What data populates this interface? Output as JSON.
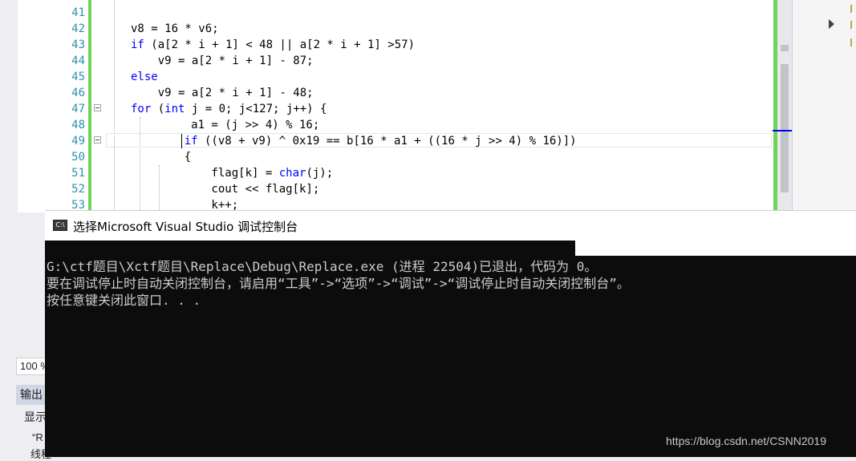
{
  "editor": {
    "line_numbers": [
      "41",
      "42",
      "43",
      "44",
      "45",
      "46",
      "47",
      "48",
      "49",
      "50",
      "51",
      "52",
      "53"
    ],
    "lines": [
      {
        "num": "42",
        "tokens": [
          {
            "t": "v8 = 16 * v6;",
            "k": 0
          }
        ]
      },
      {
        "num": "43",
        "tokens": [
          {
            "t": "if",
            "k": 1
          },
          {
            "t": " (a[2 * i + 1] < 48 || a[2 * i + 1] >57)",
            "k": 0
          }
        ]
      },
      {
        "num": "44",
        "tokens": [
          {
            "t": "    v9 = a[2 * i + 1] - 87;",
            "k": 0
          }
        ]
      },
      {
        "num": "45",
        "tokens": [
          {
            "t": "else",
            "k": 1
          }
        ]
      },
      {
        "num": "46",
        "tokens": [
          {
            "t": "    v9 = a[2 * i + 1] - 48;",
            "k": 0
          }
        ]
      },
      {
        "num": "47",
        "tokens": [
          {
            "t": "for",
            "k": 1
          },
          {
            "t": " (",
            "k": 0
          },
          {
            "t": "int",
            "k": 1
          },
          {
            "t": " j = 0; j<127; j++) {",
            "k": 0
          }
        ]
      },
      {
        "num": "48",
        "tokens": [
          {
            "t": "     a1 = (j >> 4) % 16;",
            "k": 0
          }
        ]
      },
      {
        "num": "49",
        "tokens": [
          {
            "t": "    ",
            "k": 0
          },
          {
            "t": "if",
            "k": 1
          },
          {
            "t": " ((v8 + v9) ^ 0x19 == b[16 * a1 + ((16 * j >> 4) % 16)])",
            "k": 0
          }
        ]
      },
      {
        "num": "50",
        "tokens": [
          {
            "t": "    {",
            "k": 0
          }
        ]
      },
      {
        "num": "51",
        "tokens": [
          {
            "t": "        flag[k] = ",
            "k": 0
          },
          {
            "t": "char",
            "k": 1
          },
          {
            "t": "(j);",
            "k": 0
          }
        ]
      },
      {
        "num": "52",
        "tokens": [
          {
            "t": "        cout << flag[k];",
            "k": 0
          }
        ]
      },
      {
        "num": "53",
        "tokens": [
          {
            "t": "        k++;",
            "k": 0
          }
        ]
      }
    ]
  },
  "zoom": {
    "label": "100 %"
  },
  "output": {
    "tab_label": "输出",
    "show_label": "显示",
    "fragment1": "“R",
    "fragment2": "线程"
  },
  "console": {
    "title": "选择Microsoft Visual Studio 调试控制台",
    "icon_text": "C:\\",
    "lines": [
      "G:\\ctf题目\\Xctf题目\\Replace\\Debug\\Replace.exe (进程 22504)已退出，代码为 0。",
      "要在调试停止时自动关闭控制台，请启用“工具”->“选项”->“调试”->“调试停止时自动关闭控制台”。",
      "按任意键关闭此窗口. . ."
    ]
  },
  "watermark": "https://blog.csdn.net/CSNN2019",
  "colors": {
    "keyword": "#0000ff",
    "linenumber": "#2b91af",
    "console_bg": "#0c0c0c",
    "console_text": "#cccccc",
    "change_bar": "#6fd35c"
  }
}
